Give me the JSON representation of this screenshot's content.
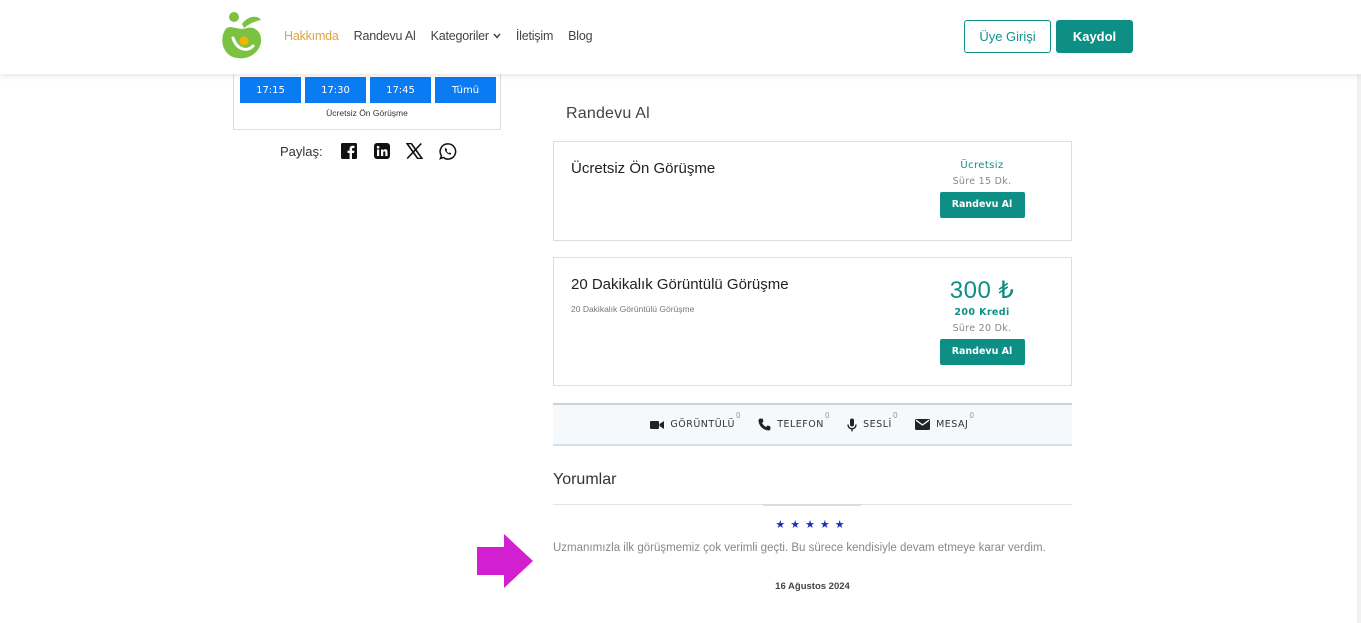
{
  "header": {
    "nav": [
      {
        "label": "Hakkımda",
        "active": true
      },
      {
        "label": "Randevu Al",
        "active": false
      },
      {
        "label": "Kategoriler",
        "active": false,
        "has_dropdown": true
      },
      {
        "label": "İletişim",
        "active": false
      },
      {
        "label": "Blog",
        "active": false
      }
    ],
    "login_label": "Üye Girişi",
    "register_label": "Kaydol"
  },
  "slots": {
    "times": [
      "17:15",
      "17:30",
      "17:45",
      "Tümü"
    ],
    "caption": "Ücretsiz Ön Görüşme"
  },
  "share": {
    "label": "Paylaş:",
    "icons": [
      "facebook-icon",
      "linkedin-icon",
      "x-icon",
      "whatsapp-icon"
    ]
  },
  "main": {
    "section_title": "Randevu Al",
    "services": [
      {
        "name": "Ücretsiz Ön Görüşme",
        "price_text": "Ücretsiz",
        "duration": "Süre 15 Dk.",
        "button": "Randevu Al"
      },
      {
        "name": "20 Dakikalık Görüntülü Görüşme",
        "description": "20 Dakikalık Görüntülü Görüşme",
        "price": "300 ₺",
        "credit": "200 Kredi",
        "duration": "Süre 20 Dk.",
        "button": "Randevu Al"
      }
    ],
    "channels": [
      {
        "label": "GÖRÜNTÜLÜ",
        "count": "0",
        "icon": "video-icon"
      },
      {
        "label": "TELEFON",
        "count": "0",
        "icon": "phone-icon"
      },
      {
        "label": "SESLİ",
        "count": "0",
        "icon": "microphone-icon"
      },
      {
        "label": "MESAJ",
        "count": "0",
        "icon": "envelope-icon"
      }
    ]
  },
  "reviews": {
    "title": "Yorumlar",
    "stars": "★★★★★",
    "rating": 5,
    "text": "Uzmanımızla ilk görüşmemiz çok verimli geçti. Bu sürece kendisiyle devam etmeye karar verdim.",
    "date": "16 Ağustos 2024"
  },
  "colors": {
    "accent": "#0d8f86",
    "slot_blue": "#0a7bf2",
    "nav_active": "#e0a43d",
    "stars": "#1c2fb3",
    "arrow": "#d21fd0"
  }
}
